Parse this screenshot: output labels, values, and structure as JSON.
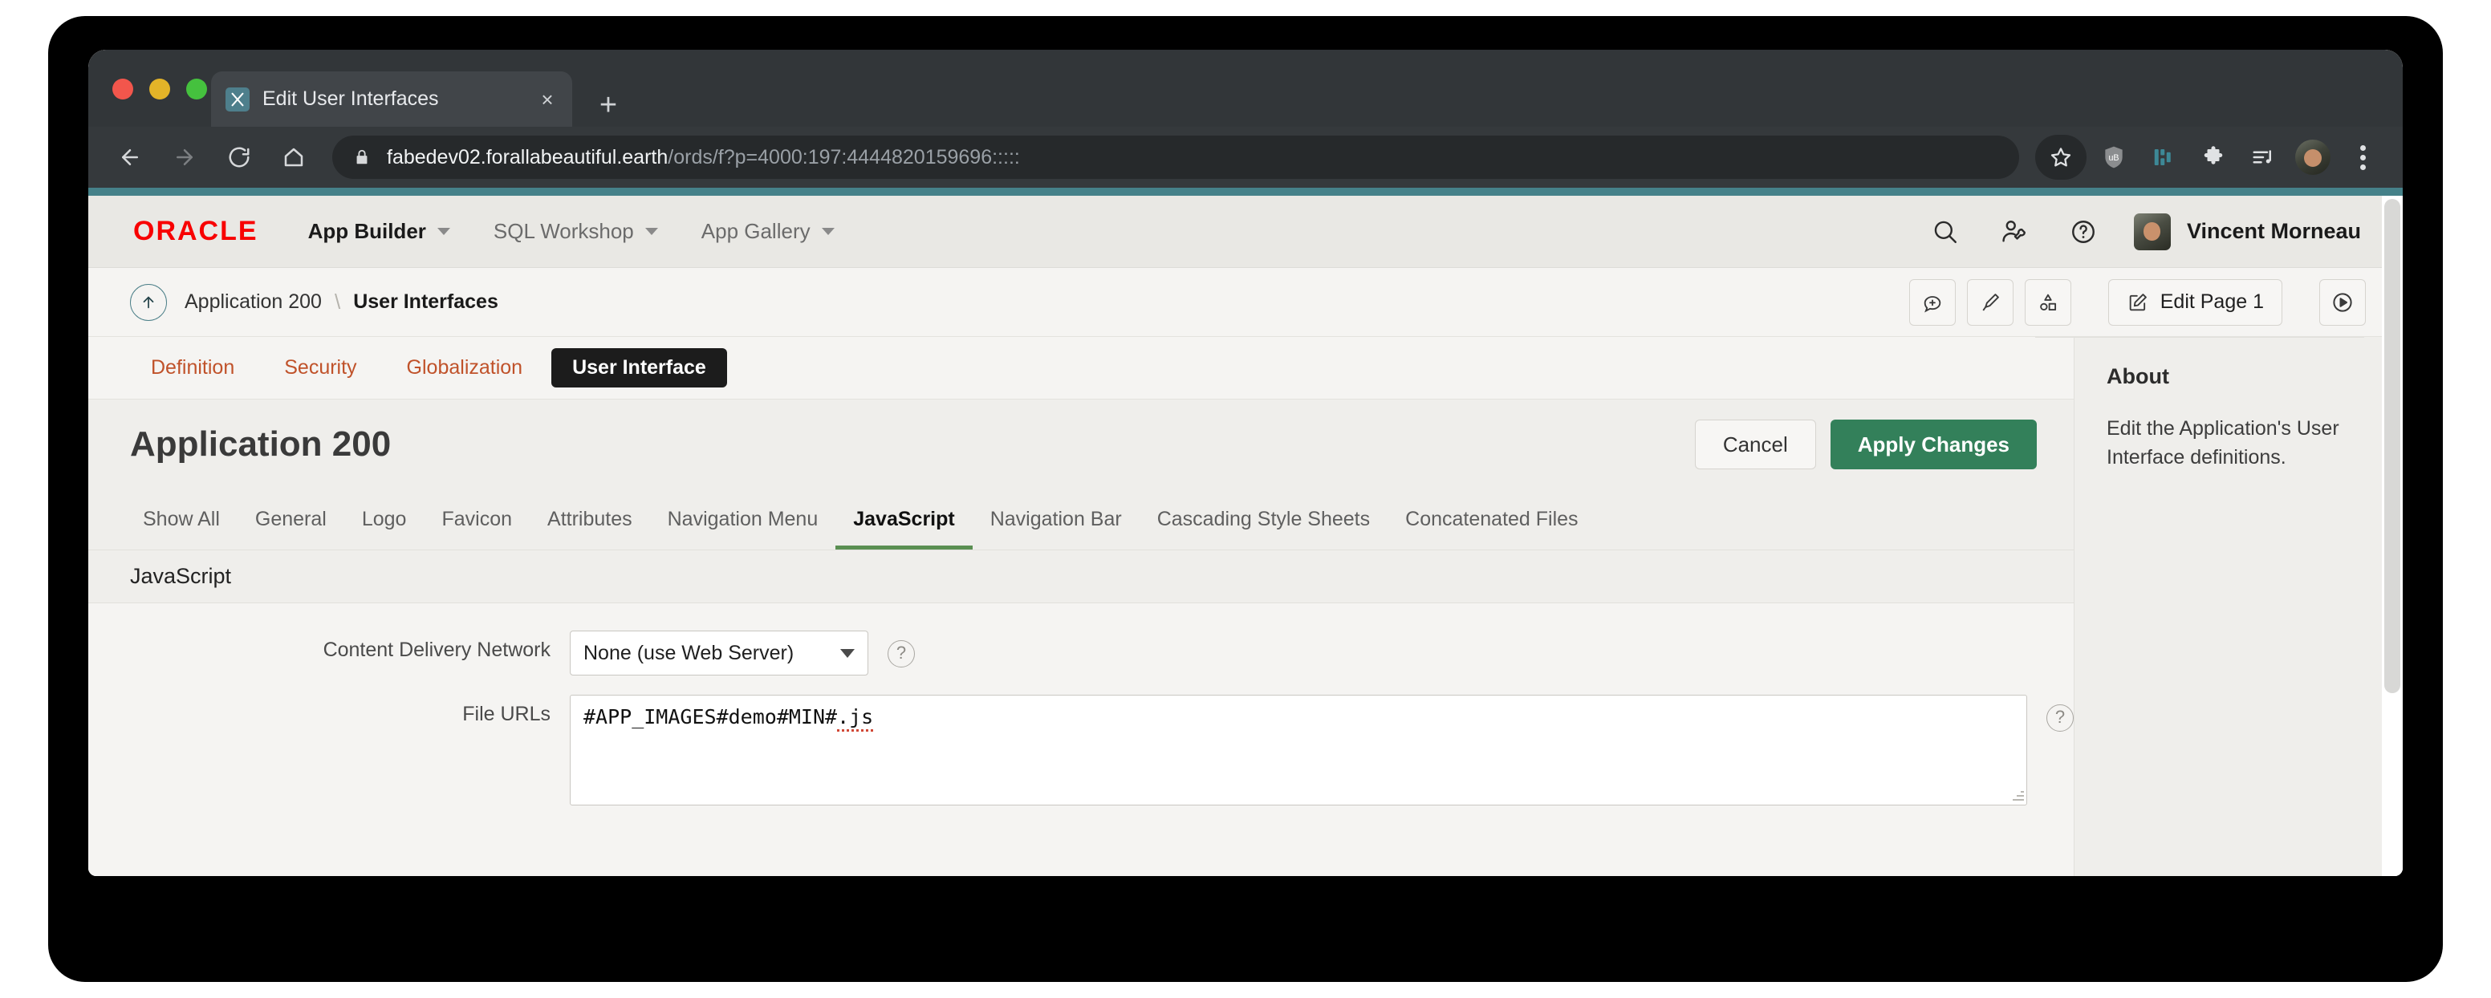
{
  "browser": {
    "tab": {
      "title": "Edit User Interfaces",
      "favicon": "apex-icon",
      "close_label": "×"
    },
    "new_tab_label": "+",
    "nav": {
      "back": "back-arrow-icon",
      "forward": "forward-arrow-icon",
      "reload": "reload-icon",
      "home": "home-icon"
    },
    "omnibox": {
      "lock": "lock-icon",
      "host": "fabedev02.forallabeautiful.earth",
      "path": "/ords/f?p=4000:197:4444820159696:::::"
    },
    "toolbar_icons": [
      {
        "name": "bookmark-star-icon"
      },
      {
        "name": "ublock-shield-icon"
      },
      {
        "name": "extension-teal-icon"
      },
      {
        "name": "puzzle-extensions-icon"
      },
      {
        "name": "media-playlist-icon"
      },
      {
        "name": "profile-avatar-icon"
      },
      {
        "name": "chrome-menu-icon"
      }
    ]
  },
  "apex": {
    "logo": "ORACLE",
    "menu": [
      {
        "label": "App Builder",
        "active": true
      },
      {
        "label": "SQL Workshop",
        "active": false
      },
      {
        "label": "App Gallery",
        "active": false
      }
    ],
    "header_icons": [
      {
        "name": "search-icon"
      },
      {
        "name": "administration-user-wrench-icon"
      },
      {
        "name": "help-circle-icon"
      }
    ],
    "user": {
      "name": "Vincent Morneau",
      "avatar": "user-avatar"
    },
    "breadcrumb": {
      "up_icon": "up-arrow-circle-icon",
      "parent": "Application 200",
      "separator": "\\",
      "current": "User Interfaces"
    },
    "breadcrumb_actions": [
      {
        "name": "add-comment-button",
        "icon": "comment-plus-icon",
        "label": ""
      },
      {
        "name": "theme-roller-button",
        "icon": "brush-icon",
        "label": ""
      },
      {
        "name": "utilities-button",
        "icon": "shapes-icon",
        "label": ""
      },
      {
        "name": "edit-page-button",
        "icon": "pencil-square-icon",
        "label": "Edit Page 1"
      },
      {
        "name": "run-application-button",
        "icon": "play-circle-icon",
        "label": ""
      }
    ],
    "primary_tabs": [
      {
        "label": "Definition",
        "active": false
      },
      {
        "label": "Security",
        "active": false
      },
      {
        "label": "Globalization",
        "active": false
      },
      {
        "label": "User Interface",
        "active": true
      }
    ],
    "page_title": "Application 200",
    "buttons": {
      "cancel": "Cancel",
      "apply": "Apply Changes"
    },
    "sub_tabs": [
      {
        "label": "Show All",
        "active": false
      },
      {
        "label": "General",
        "active": false
      },
      {
        "label": "Logo",
        "active": false
      },
      {
        "label": "Favicon",
        "active": false
      },
      {
        "label": "Attributes",
        "active": false
      },
      {
        "label": "Navigation Menu",
        "active": false
      },
      {
        "label": "JavaScript",
        "active": true
      },
      {
        "label": "Navigation Bar",
        "active": false
      },
      {
        "label": "Cascading Style Sheets",
        "active": false
      },
      {
        "label": "Concatenated Files",
        "active": false
      }
    ],
    "region": {
      "title": "JavaScript"
    },
    "fields": {
      "cdn": {
        "label": "Content Delivery Network",
        "value": "None (use Web Server)",
        "help": "?"
      },
      "file_urls": {
        "label": "File URLs",
        "value_plain": "#APP_IMAGES#demo#MIN#",
        "value_spell": ".js",
        "help": "?"
      }
    },
    "about": {
      "title": "About",
      "text": "Edit the Application's User Interface definitions."
    }
  },
  "colors": {
    "oracle_red": "#f80000",
    "apply_green": "#33805a",
    "tab_orange": "#c0522a",
    "active_tab_underline": "#5a8f52",
    "teal_strip": "#458189"
  }
}
